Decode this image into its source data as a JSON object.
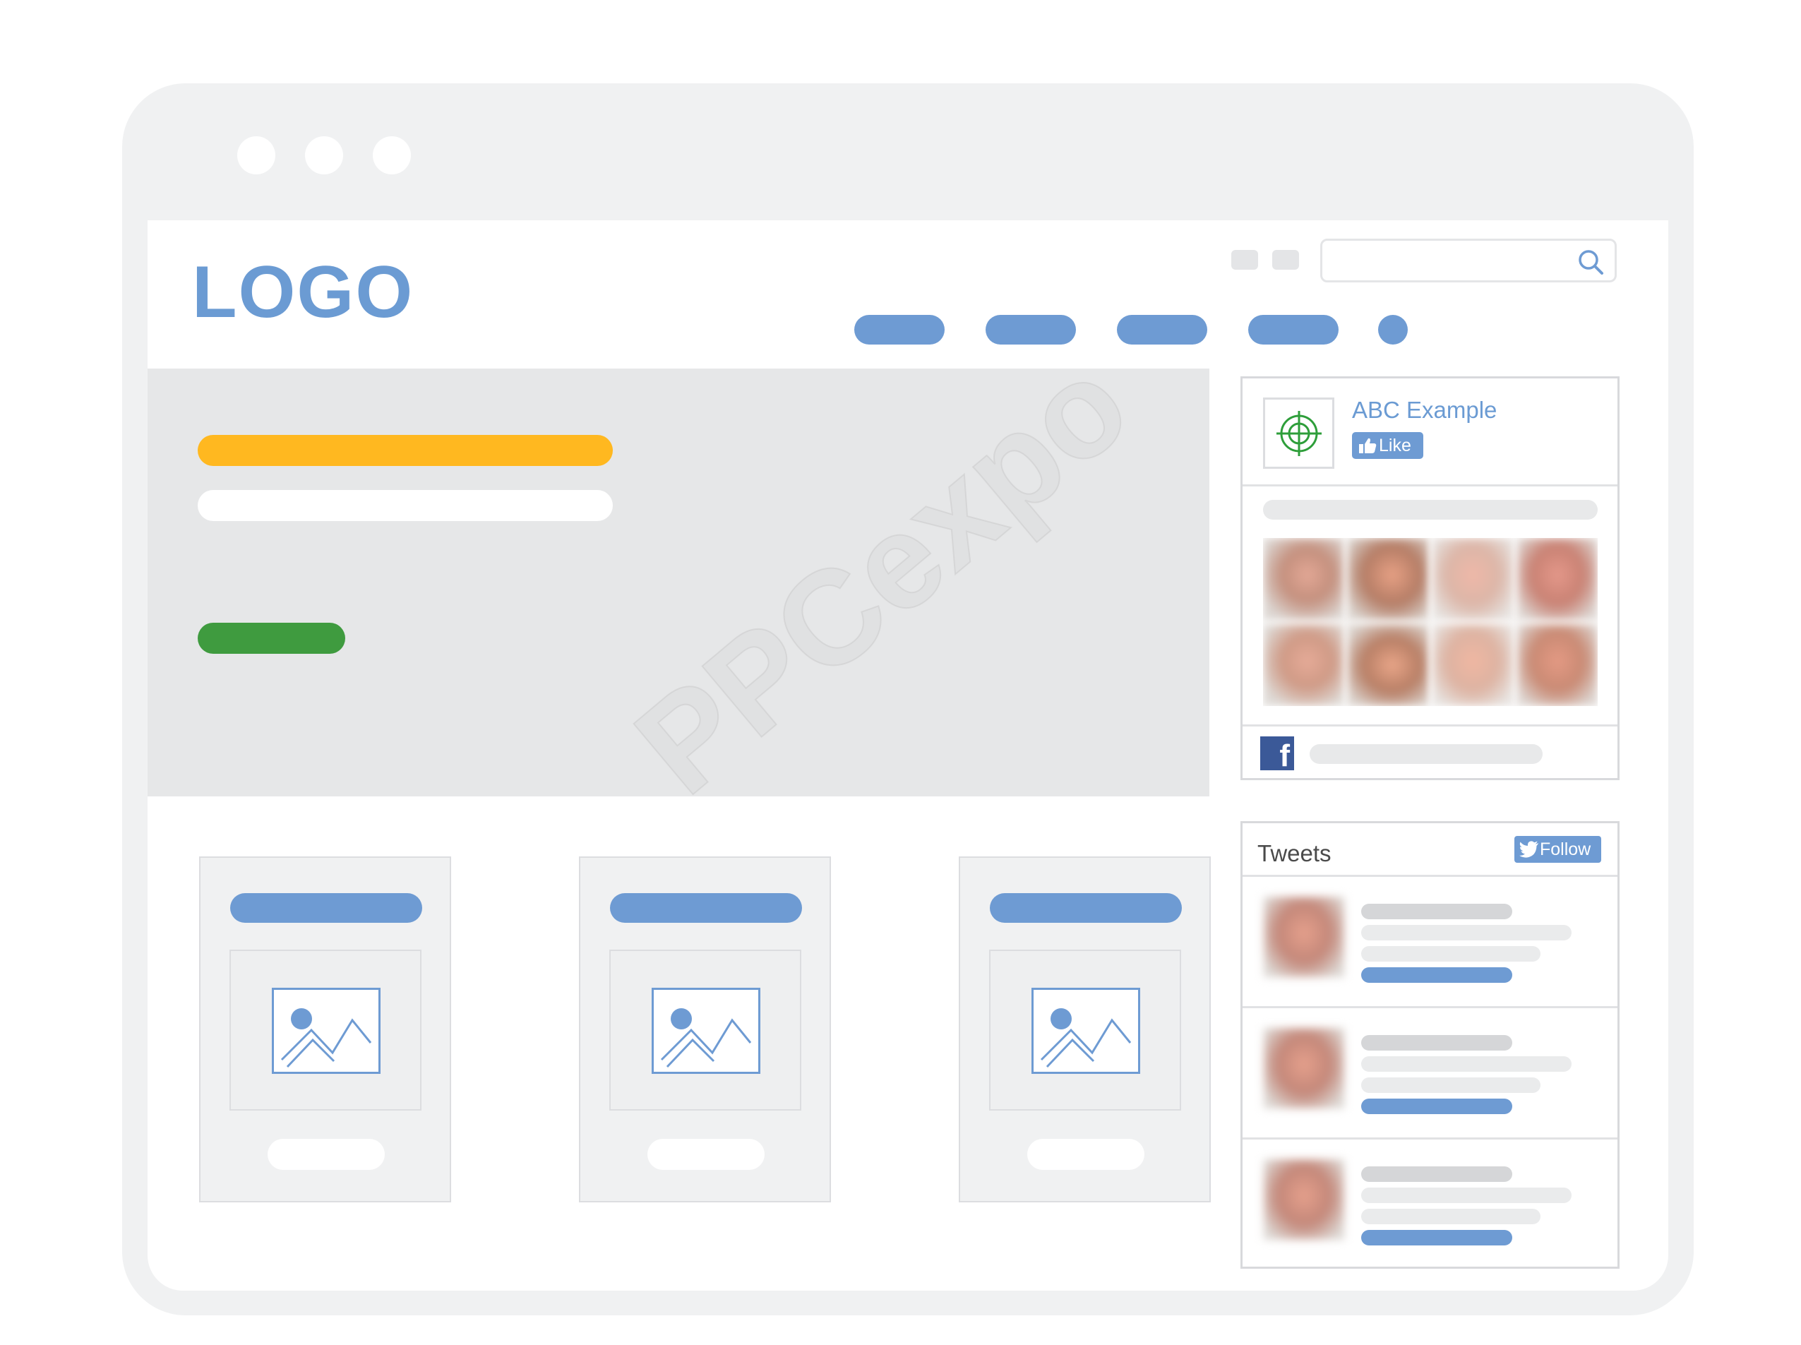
{
  "logo": {
    "text": "LOGO"
  },
  "facebook_widget": {
    "page_name": "ABC Example",
    "like_label": "Like",
    "facebook_glyph": "f"
  },
  "twitter_widget": {
    "title": "Tweets",
    "follow_label": "Follow"
  },
  "watermark": {
    "text": "PPCexpo"
  },
  "colors": {
    "accent_blue": "#6e9bd3",
    "cta_yellow": "#ffb820",
    "cta_green": "#3f9b3f",
    "facebook_blue": "#3b5998",
    "target_green": "#2e9e3a",
    "frame_gray": "#f0f1f2",
    "hero_gray": "#e6e7e8"
  },
  "icons": [
    "search-icon",
    "target-icon",
    "thumbs-up-icon",
    "facebook-icon",
    "twitter-bird-icon",
    "image-placeholder-icon"
  ]
}
